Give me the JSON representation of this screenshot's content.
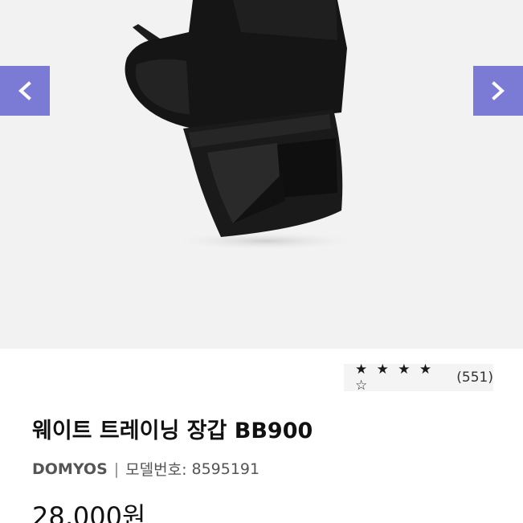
{
  "carousel": {
    "prev_icon": "chevron-left-icon",
    "next_icon": "chevron-right-icon",
    "accent_color": "#7b7bd6",
    "image_subject": "black weight training glove"
  },
  "product": {
    "rating_stars": "★ ★ ★ ★ ☆",
    "rating_value": 4,
    "rating_max": 5,
    "review_count": "(551)",
    "title": "웨이트 트레이닝 장갑 BB900",
    "brand": "DOMYOS",
    "separator": "|",
    "model_label": "모델번호:",
    "model_number": "8595191",
    "price": "28,000원"
  }
}
